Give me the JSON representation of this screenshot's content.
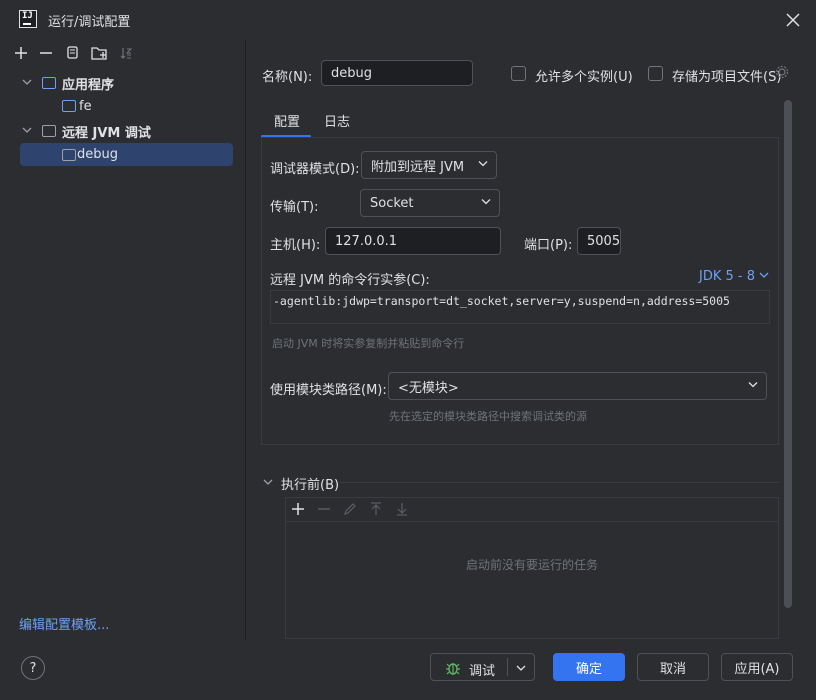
{
  "window": {
    "title": "运行/调试配置"
  },
  "tree": {
    "items": [
      {
        "label": "应用程序",
        "expanded": true
      },
      {
        "label": "fe"
      },
      {
        "label": "远程 JVM 调试",
        "expanded": true
      },
      {
        "label": "debug",
        "selected": true
      }
    ],
    "edit_templates_link": "编辑配置模板..."
  },
  "form": {
    "name_label": "名称(N):",
    "name_value": "debug",
    "allow_multiple_label": "允许多个实例(U)",
    "store_as_project_label": "存储为项目文件(S)",
    "tabs": [
      {
        "label": "配置",
        "active": true
      },
      {
        "label": "日志",
        "active": false
      }
    ],
    "debugger_mode_label": "调试器模式(D):",
    "debugger_mode_value": "附加到远程 JVM",
    "transport_label": "传输(T):",
    "transport_value": "Socket",
    "host_label": "主机(H):",
    "host_value": "127.0.0.1",
    "port_label": "端口(P):",
    "port_value": "5005",
    "cmd_args_label": "远程 JVM 的命令行实参(C):",
    "jdk_link": "JDK 5 - 8",
    "cmd_args_value": "-agentlib:jdwp=transport=dt_socket,server=y,suspend=n,address=5005",
    "cmd_args_hint": "启动 JVM 时将实参复制并粘贴到命令行",
    "module_label": "使用模块类路径(M):",
    "module_value": "<无模块>",
    "module_hint": "先在选定的模块类路径中搜索调试类的源",
    "before_launch_label": "执行前(B)",
    "before_launch_empty": "启动前没有要运行的任务"
  },
  "footer": {
    "help_label": "?",
    "debug_button": "调试",
    "ok_button": "确定",
    "cancel_button": "取消",
    "apply_button": "应用(A)"
  },
  "colors": {
    "background": "#2b2d30",
    "accent": "#3574f0",
    "selection": "#2e436e",
    "link": "#6ea0f5"
  }
}
